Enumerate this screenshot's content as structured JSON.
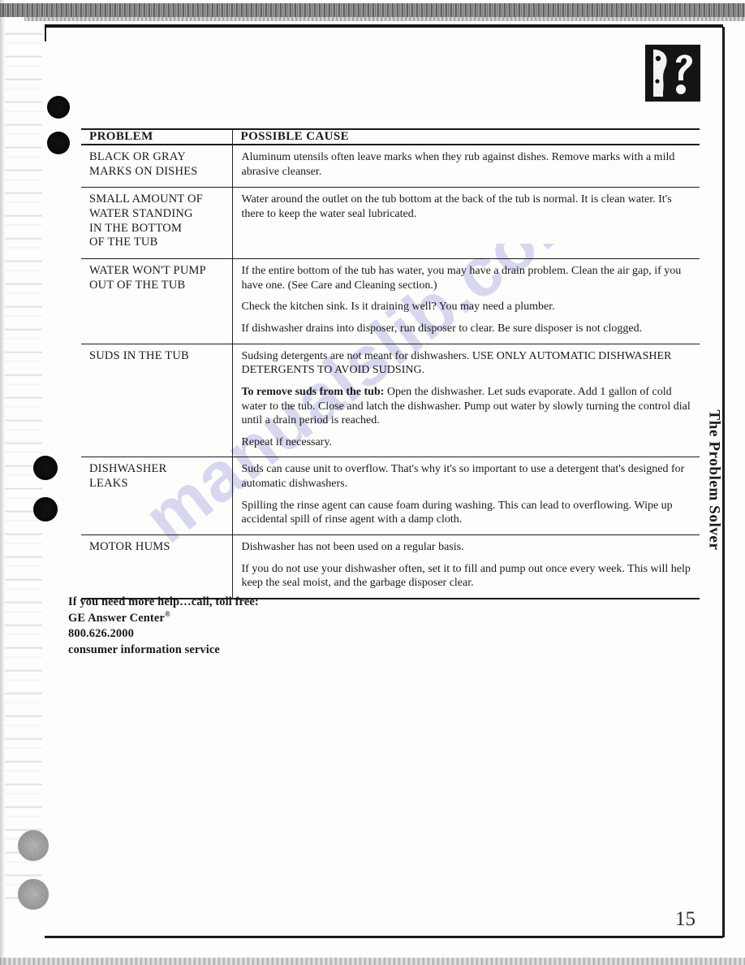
{
  "page": {
    "number": "15",
    "side_tab_label": "The Problem Solver",
    "header_icon": "question-mark-face-icon",
    "watermark_text": "manualslib.com"
  },
  "table": {
    "headers": {
      "problem": "PROBLEM",
      "cause": "POSSIBLE CAUSE"
    },
    "rows": [
      {
        "problem": "BLACK OR GRAY\nMARKS ON DISHES",
        "causes": [
          "Aluminum utensils often leave marks when they rub against dishes. Remove marks with a mild abrasive cleanser."
        ]
      },
      {
        "problem": "SMALL AMOUNT OF\nWATER STANDING\nIN THE BOTTOM\nOF THE TUB",
        "causes": [
          "Water around the outlet on the tub bottom at the back of the tub is normal. It is clean water. It's there to keep the water seal lubricated."
        ]
      },
      {
        "problem": "WATER WON'T PUMP\nOUT OF THE TUB",
        "causes": [
          "If the entire bottom of the tub has water, you may have a drain problem. Clean the air gap, if you have one. (See Care and Cleaning section.)",
          "Check the kitchen sink. Is it draining well? You may need a plumber.",
          "If dishwasher drains into disposer, run disposer to clear. Be sure disposer is not clogged."
        ]
      },
      {
        "problem": "SUDS IN THE TUB",
        "causes": [
          "Sudsing detergents are not meant for dishwashers. USE ONLY AUTOMATIC DISHWASHER DETERGENTS TO AVOID SUDSING.",
          "To remove suds from the tub: Open the dishwasher. Let suds evaporate. Add 1 gallon of cold water to the tub. Close and latch the dishwasher. Pump out water by slowly turning the control dial until a drain period is reached.",
          "Repeat if necessary."
        ],
        "bold_lead": [
          null,
          "To remove suds from the tub:",
          null
        ]
      },
      {
        "problem": "DISHWASHER\nLEAKS",
        "causes": [
          "Suds can cause unit to overflow. That's why it's so important to use a detergent that's designed for automatic dishwashers.",
          "Spilling the rinse agent can cause foam during washing. This can lead to overflowing. Wipe up accidental spill of rinse agent with a damp cloth."
        ]
      },
      {
        "problem": "MOTOR HUMS",
        "causes": [
          "Dishwasher has not been used on a regular basis.",
          "If you do not use your dishwasher often, set it to fill and pump out once every week. This will help keep the seal moist, and the garbage disposer clear."
        ]
      }
    ]
  },
  "help": {
    "line1": "If you need more help…call, toll free:",
    "line2": "GE Answer Center",
    "line2_sup": "®",
    "line3": "800.626.2000",
    "line4": "consumer information service"
  }
}
